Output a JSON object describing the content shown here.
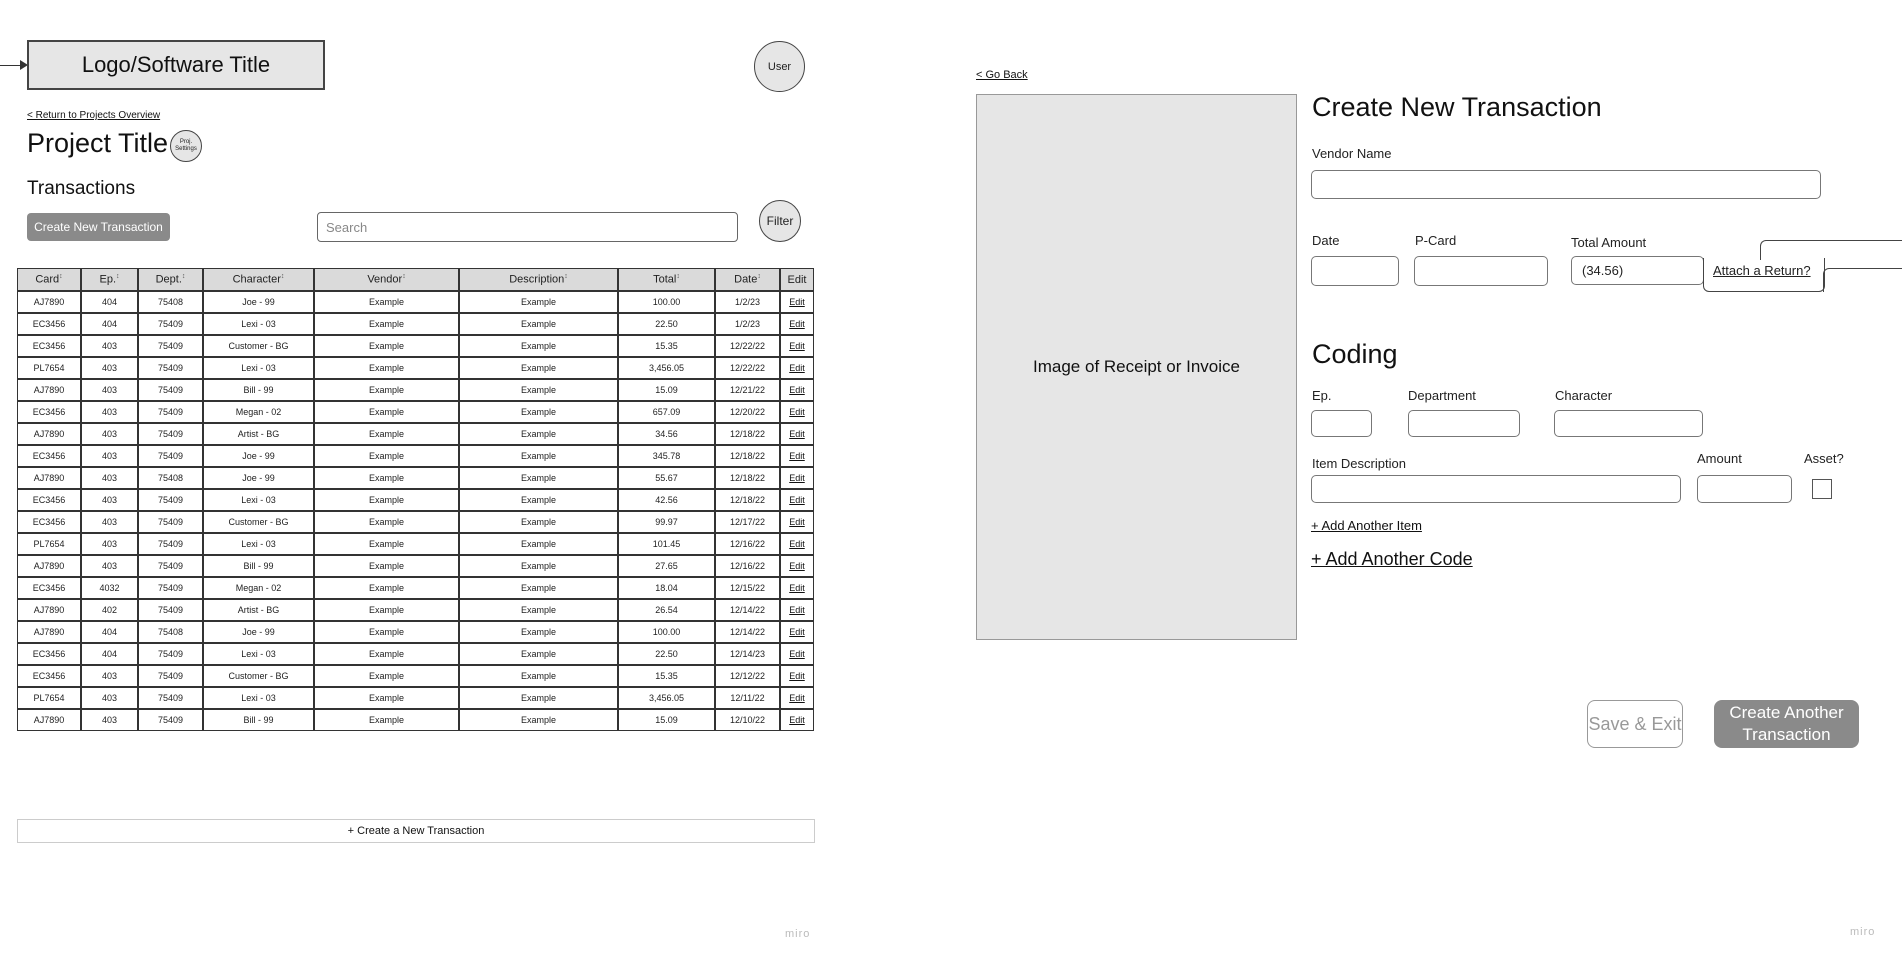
{
  "header": {
    "logo_text": "Logo/Software Title",
    "user_label": "User"
  },
  "project": {
    "return_link": "< Return to Projects Overview",
    "title": "Project Title",
    "settings_line1": "Proj.",
    "settings_line2": "Settings"
  },
  "transactions": {
    "heading": "Transactions",
    "create_button": "Create New Transaction",
    "search_placeholder": "Search",
    "filter_label": "Filter",
    "columns": [
      "Card",
      "Ep.",
      "Dept.",
      "Character",
      "Vendor",
      "Description",
      "Total",
      "Date",
      "Edit"
    ],
    "rows": [
      [
        "AJ7890",
        "404",
        "75408",
        "Joe - 99",
        "Example",
        "Example",
        "100.00",
        "1/2/23",
        "Edit"
      ],
      [
        "EC3456",
        "404",
        "75409",
        "Lexi - 03",
        "Example",
        "Example",
        "22.50",
        "1/2/23",
        "Edit"
      ],
      [
        "EC3456",
        "403",
        "75409",
        "Customer - BG",
        "Example",
        "Example",
        "15.35",
        "12/22/22",
        "Edit"
      ],
      [
        "PL7654",
        "403",
        "75409",
        "Lexi - 03",
        "Example",
        "Example",
        "3,456.05",
        "12/22/22",
        "Edit"
      ],
      [
        "AJ7890",
        "403",
        "75409",
        "Bill - 99",
        "Example",
        "Example",
        "15.09",
        "12/21/22",
        "Edit"
      ],
      [
        "EC3456",
        "403",
        "75409",
        "Megan - 02",
        "Example",
        "Example",
        "657.09",
        "12/20/22",
        "Edit"
      ],
      [
        "AJ7890",
        "403",
        "75409",
        "Artist - BG",
        "Example",
        "Example",
        "34.56",
        "12/18/22",
        "Edit"
      ],
      [
        "EC3456",
        "403",
        "75409",
        "Joe - 99",
        "Example",
        "Example",
        "345.78",
        "12/18/22",
        "Edit"
      ],
      [
        "AJ7890",
        "403",
        "75408",
        "Joe - 99",
        "Example",
        "Example",
        "55.67",
        "12/18/22",
        "Edit"
      ],
      [
        "EC3456",
        "403",
        "75409",
        "Lexi - 03",
        "Example",
        "Example",
        "42.56",
        "12/18/22",
        "Edit"
      ],
      [
        "EC3456",
        "403",
        "75409",
        "Customer - BG",
        "Example",
        "Example",
        "99.97",
        "12/17/22",
        "Edit"
      ],
      [
        "PL7654",
        "403",
        "75409",
        "Lexi - 03",
        "Example",
        "Example",
        "101.45",
        "12/16/22",
        "Edit"
      ],
      [
        "AJ7890",
        "403",
        "75409",
        "Bill - 99",
        "Example",
        "Example",
        "27.65",
        "12/16/22",
        "Edit"
      ],
      [
        "EC3456",
        "4032",
        "75409",
        "Megan - 02",
        "Example",
        "Example",
        "18.04",
        "12/15/22",
        "Edit"
      ],
      [
        "AJ7890",
        "402",
        "75409",
        "Artist - BG",
        "Example",
        "Example",
        "26.54",
        "12/14/22",
        "Edit"
      ],
      [
        "AJ7890",
        "404",
        "75408",
        "Joe - 99",
        "Example",
        "Example",
        "100.00",
        "12/14/22",
        "Edit"
      ],
      [
        "EC3456",
        "404",
        "75409",
        "Lexi - 03",
        "Example",
        "Example",
        "22.50",
        "12/14/23",
        "Edit"
      ],
      [
        "EC3456",
        "403",
        "75409",
        "Customer - BG",
        "Example",
        "Example",
        "15.35",
        "12/12/22",
        "Edit"
      ],
      [
        "PL7654",
        "403",
        "75409",
        "Lexi - 03",
        "Example",
        "Example",
        "3,456.05",
        "12/11/22",
        "Edit"
      ],
      [
        "AJ7890",
        "403",
        "75409",
        "Bill - 99",
        "Example",
        "Example",
        "15.09",
        "12/10/22",
        "Edit"
      ]
    ],
    "create_row_label": "+ Create a New Transaction",
    "sortable_columns": [
      "Card",
      "Ep.",
      "Dept.",
      "Character",
      "Vendor",
      "Description",
      "Total",
      "Date"
    ]
  },
  "watermark": "miro",
  "form": {
    "go_back": "< Go Back",
    "receipt_placeholder": "Image of Receipt or Invoice",
    "title": "Create New Transaction",
    "vendor_label": "Vendor Name",
    "vendor_value": "",
    "date_label": "Date",
    "pcard_label": "P-Card",
    "total_label": "Total Amount",
    "total_value": "(34.56)",
    "attach_return": "Attach a Return?",
    "coding_heading": "Coding",
    "ep_label": "Ep.",
    "department_label": "Department",
    "character_label": "Character",
    "item_description_label": "Item Description",
    "amount_label": "Amount",
    "asset_label": "Asset?",
    "add_item": "+ Add Another Item",
    "add_code": "+ Add Another Code",
    "save_exit": "Save & Exit",
    "create_another": "Create Another Transaction"
  },
  "colors": {
    "button_gray": "#8a8a8a",
    "panel_gray": "#e6e6e6",
    "header_gray": "#dadada"
  }
}
